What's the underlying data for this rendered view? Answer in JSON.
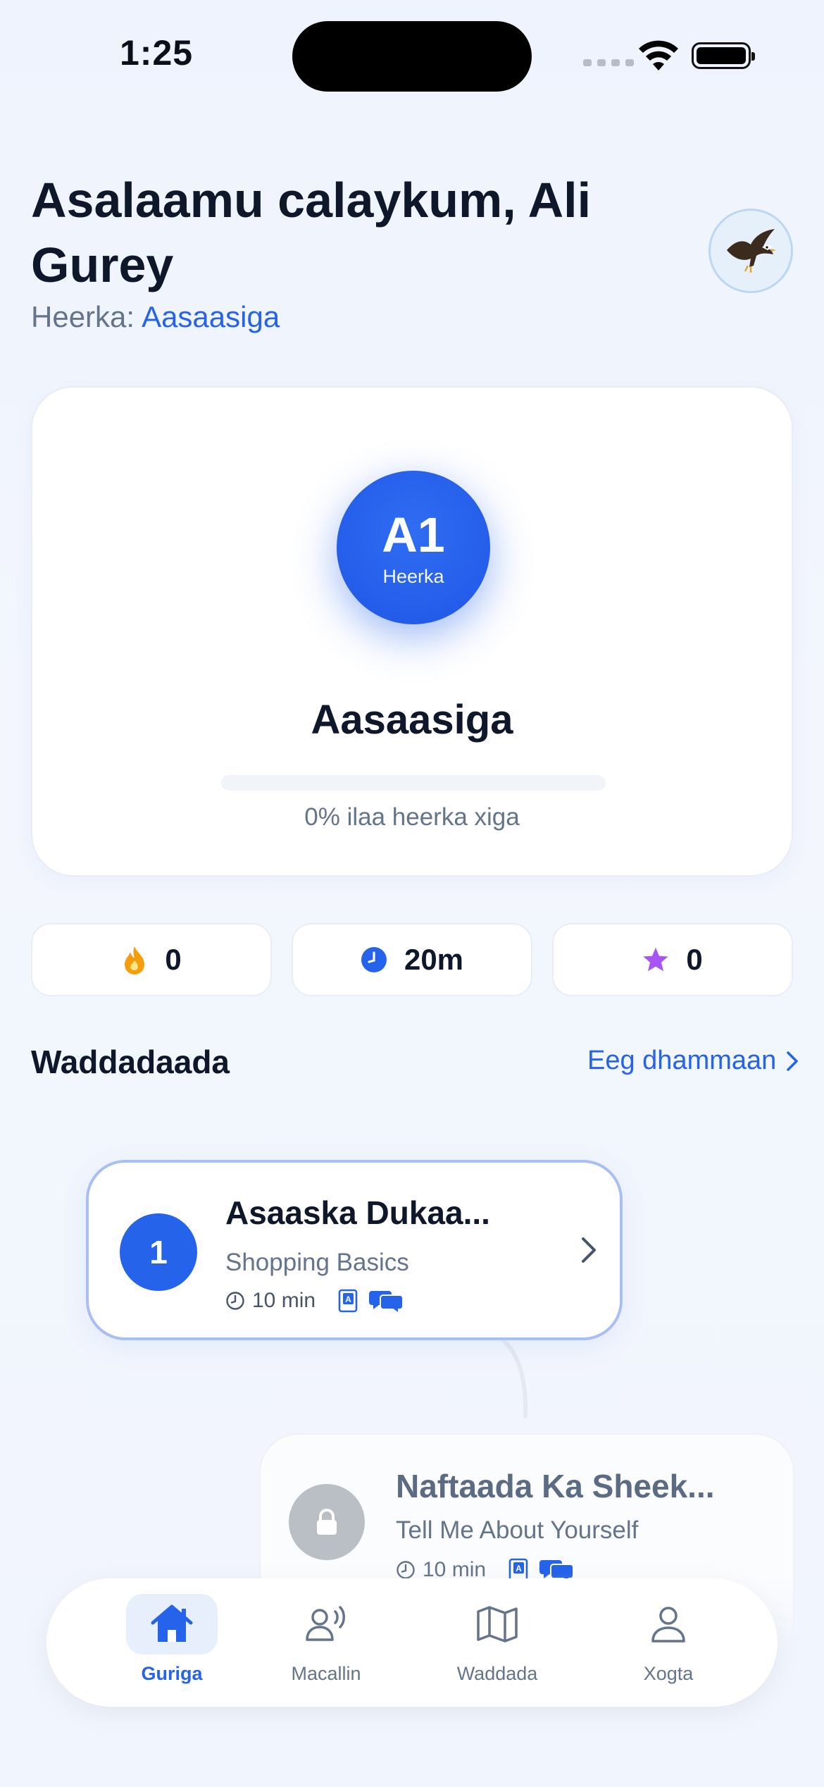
{
  "status_bar": {
    "time": "1:25"
  },
  "header": {
    "greeting": "Asalaamu calaykum, Ali Gurey",
    "level_prefix": "Heerka:",
    "level_name": "Aasaasiga",
    "avatar_icon": "eagle-icon"
  },
  "level_card": {
    "code": "A1",
    "badge_label": "Heerka",
    "title": "Aasaasiga",
    "progress": 0,
    "progress_text": "0% ilaa heerka xiga"
  },
  "stats": [
    {
      "icon": "flame-icon",
      "value": "0",
      "color": "#f59e0b"
    },
    {
      "icon": "clock-icon",
      "value": "20m",
      "color": "#2563eb"
    },
    {
      "icon": "star-icon",
      "value": "0",
      "color": "#a855f7"
    }
  ],
  "section": {
    "title": "Waddadaada",
    "see_all": "Eeg dhammaan"
  },
  "lessons": [
    {
      "number": "1",
      "title": "Asaaska Dukaa...",
      "subtitle": "Shopping Basics",
      "duration": "10 min",
      "state": "active"
    },
    {
      "number": "",
      "title": "Naftaada Ka Sheek...",
      "subtitle": "Tell Me About Yourself",
      "duration": "10 min",
      "state": "locked"
    }
  ],
  "tabs": [
    {
      "label": "Guriga",
      "icon": "home-icon",
      "selected": true
    },
    {
      "label": "Macallin",
      "icon": "voice-teacher-icon",
      "selected": false
    },
    {
      "label": "Waddada",
      "icon": "map-icon",
      "selected": false
    },
    {
      "label": "Xogta",
      "icon": "profile-icon",
      "selected": false
    }
  ],
  "colors": {
    "accent": "#2563eb",
    "text": "#0f172a",
    "muted": "#64748b"
  }
}
